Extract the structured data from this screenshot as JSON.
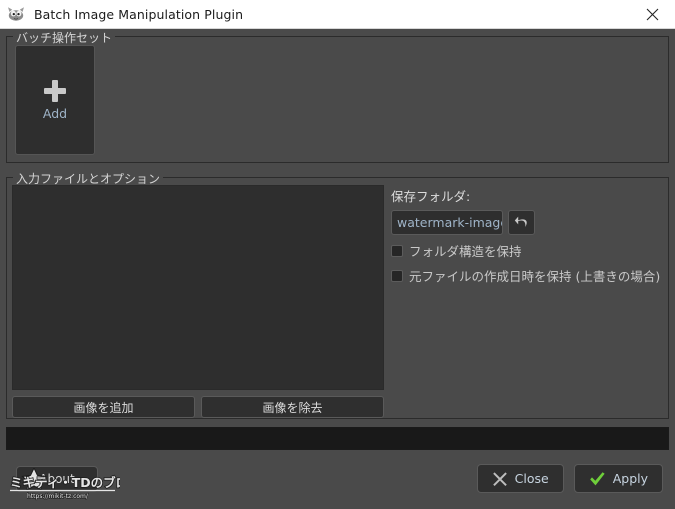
{
  "window": {
    "title": "Batch Image Manipulation Plugin",
    "icon": "gimp-wilber-icon",
    "close_icon": "close-icon"
  },
  "batch_group": {
    "title": "バッチ操作セット",
    "add_tile": {
      "icon": "plus-icon",
      "label": "Add"
    }
  },
  "input_group": {
    "title": "入力ファイルとオプション",
    "file_list": {
      "items": []
    },
    "buttons": {
      "add_images": "画像を追加",
      "remove_images": "画像を除去"
    }
  },
  "options": {
    "output_folder_label": "保存フォルダ:",
    "output_folder_value": "watermark-image",
    "output_folder_placeholder": "watermark-image",
    "reset_icon": "undo-arrow-icon",
    "checkboxes": [
      {
        "label": "フォルダ構造を保持",
        "checked": false
      },
      {
        "label": "元ファイルの作成日時を保持 (上書きの場合)",
        "checked": false
      }
    ]
  },
  "progress": {
    "value": 0,
    "text": ""
  },
  "footer": {
    "about_label": "About",
    "close_label": "Close",
    "close_icon": "x-mark-icon",
    "apply_label": "Apply",
    "apply_icon": "check-mark-icon"
  },
  "watermark": {
    "text": "ミキティ・TDのブログ",
    "url": "https://mikit-tz.com/",
    "star_icon": "star-icon"
  },
  "colors": {
    "window_bg": "#4a4a4a",
    "panel_bg": "#2e2e2e",
    "titlebar_bg": "#ffffff",
    "accent_text": "#9fb4c8",
    "apply_green": "#6fce3a",
    "close_gray": "#bdbdbd"
  }
}
